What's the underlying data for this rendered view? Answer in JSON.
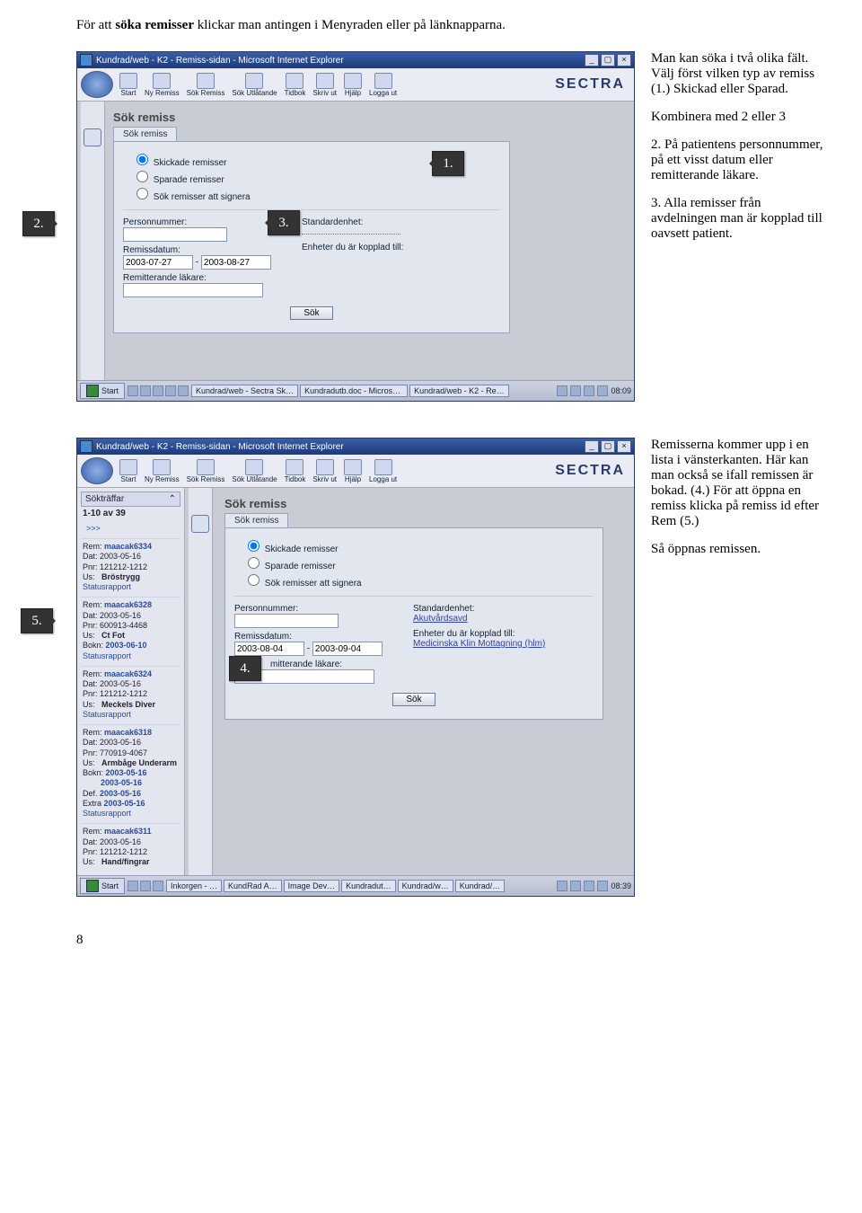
{
  "intro": {
    "pre": "För att ",
    "bold": "söka remisser",
    "post": " klickar man antingen i Menyraden eller på länknapparna."
  },
  "side_a": {
    "p1": "Man kan söka i två olika fält. Välj först vilken typ av remiss (1.) Skickad eller Sparad.",
    "p2": "Kombinera med 2 eller 3",
    "p3": "2. På patientens personnummer, på ett visst datum eller remitterande läkare.",
    "p4": "3. Alla remisser från avdelningen man är kopplad till oavsett patient."
  },
  "side_b": {
    "p1": "Remisserna kommer upp i en lista i vänsterkanten. Här kan man också se ifall remissen är bokad. (4.) För att öppna en remiss klicka på remiss id efter Rem (5.)",
    "p2": "Så öppnas remissen."
  },
  "callouts": {
    "c1": "1.",
    "c2": "2.",
    "c3": "3.",
    "c4": "4.",
    "c5": "5."
  },
  "win": {
    "title": "Kundrad/web - K2 - Remiss-sidan - Microsoft Internet Explorer",
    "brand": "SECTRA",
    "toolbar": [
      "Start",
      "Ny Remiss",
      "Sök Remiss",
      "Sök Utlåtande",
      "Tidbok",
      "Skriv ut",
      "Hjälp",
      "Logga ut"
    ],
    "panel_title": "Sök remiss",
    "subtab": "Sök remiss",
    "radios": {
      "skickade": "Skickade remisser",
      "sparade": "Sparade remisser",
      "signera": "Sök remisser att signera"
    },
    "pnr_label": "Personnummer:",
    "remissdatum_label": "Remissdatum:",
    "remitt_label": "Remitterande läkare:",
    "std_label": "Standardenhet:",
    "enheter_label": "Enheter du är kopplad till:",
    "sok_btn": "Sök"
  },
  "form_a": {
    "date_from": "2003-07-27",
    "date_to": "2003-08-27"
  },
  "form_b": {
    "date_from": "2003-08-04",
    "date_to": "2003-09-04",
    "std_link": "Akutvårdsavd",
    "enheter_link": "Medicinska Klin Mottagning (hlm)"
  },
  "taskbar_a": {
    "start": "Start",
    "items": [
      "Kundrad/web - Sectra Sk…",
      "Kundradutb.doc - Microso…",
      "Kundrad/web - K2 - Re…"
    ],
    "time": "08:09"
  },
  "taskbar_b": {
    "start": "Start",
    "items": [
      "Inkorgen - …",
      "KundRad A…",
      "Image Dev…",
      "Kundradut…",
      "Kundrad/w…",
      "Kundrad/…"
    ],
    "time": "08:39"
  },
  "hits": {
    "header": "Sökträffar",
    "counter": "1-10 av 39",
    "more": ">>>",
    "rows": [
      {
        "rem": "maacak6334",
        "dat": "2003-05-16",
        "pnr": "121212-1212",
        "us": "Bröstrygg",
        "extra": "Statusrapport"
      },
      {
        "rem": "maacak6328",
        "dat": "2003-05-16",
        "pnr": "600913-4468",
        "us": "Ct Fot",
        "bokn": "2003-06-10",
        "extra": "Statusrapport"
      },
      {
        "rem": "maacak6324",
        "dat": "2003-05-16",
        "pnr": "121212-1212",
        "us": "Meckels Diver",
        "extra": "Statusrapport"
      },
      {
        "rem": "maacak6318",
        "dat": "2003-05-16",
        "pnr": "770919-4067",
        "us": "Armbåge Underarm",
        "bokn": "2003-05-16\n2003-05-16",
        "def": "2003-05-16",
        "extra2": "2003-05-16",
        "extra": "Statusrapport"
      },
      {
        "rem": "maacak6311",
        "dat": "2003-05-16",
        "pnr": "121212-1212",
        "us": "Hand/fingrar"
      }
    ],
    "labels": {
      "rem": "Rem:",
      "dat": "Dat:",
      "pnr": "Pnr:",
      "us": "Us:",
      "bokn": "Bokn:",
      "def": "Def.",
      "extralbl": "Extra"
    }
  },
  "page_number": "8"
}
